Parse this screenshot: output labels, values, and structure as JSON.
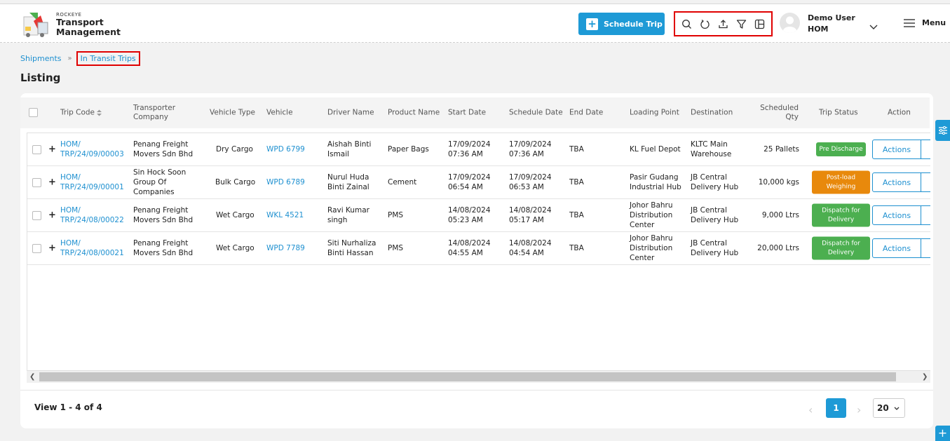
{
  "app": {
    "brand_small": "ROCKEYE",
    "brand_line1": "Transport",
    "brand_line2": "Management"
  },
  "header": {
    "schedule_label": "Schedule Trip",
    "tool_icons": [
      "search-icon",
      "refresh-icon",
      "upload-icon",
      "filter-icon",
      "columns-icon"
    ],
    "user_name": "Demo User",
    "user_org": "HOM",
    "menu_label": "Menu"
  },
  "breadcrumb": {
    "parent": "Shipments",
    "separator": "»",
    "current": "In Transit Trips"
  },
  "page": {
    "title": "Listing"
  },
  "table": {
    "columns": {
      "trip_code": "Trip Code",
      "transporter": "Transporter Company",
      "vehicle_type": "Vehicle Type",
      "vehicle": "Vehicle",
      "driver": "Driver Name",
      "product": "Product Name",
      "start_date": "Start Date",
      "schedule_date": "Schedule Date",
      "end_date": "End Date",
      "loading_point": "Loading Point",
      "destination": "Destination",
      "qty": "Scheduled Qty",
      "status": "Trip Status",
      "action": "Action"
    },
    "rows": [
      {
        "trip_code": "HOM/ TRP/24/09/00003",
        "transporter": "Penang Freight Movers Sdn Bhd",
        "vehicle_type": "Dry Cargo",
        "vehicle": "WPD 6799",
        "driver": "Aishah Binti Ismail",
        "product": "Paper Bags",
        "start_date": "17/09/2024 07:36 AM",
        "schedule_date": "17/09/2024 07:36 AM",
        "end_date": "TBA",
        "loading_point": "KL Fuel Depot",
        "destination": "KLTC Main Warehouse",
        "qty": "25 Pallets",
        "status": "Pre Discharge",
        "status_color": "#4caf50",
        "action_label": "Actions"
      },
      {
        "trip_code": "HOM/ TRP/24/09/00001",
        "transporter": "Sin Hock Soon Group Of Companies",
        "vehicle_type": "Bulk Cargo",
        "vehicle": "WPD 6789",
        "driver": "Nurul Huda Binti Zainal",
        "product": "Cement",
        "start_date": "17/09/2024 06:54 AM",
        "schedule_date": "17/09/2024 06:53 AM",
        "end_date": "TBA",
        "loading_point": "Pasir Gudang Industrial Hub",
        "destination": "JB Central Delivery Hub",
        "qty": "10,000 kgs",
        "status": "Post-load Weighing",
        "status_color": "#e8890c",
        "action_label": "Actions"
      },
      {
        "trip_code": "HOM/ TRP/24/08/00022",
        "transporter": "Penang Freight Movers Sdn Bhd",
        "vehicle_type": "Wet Cargo",
        "vehicle": "WKL 4521",
        "driver": "Ravi Kumar singh",
        "product": "PMS",
        "start_date": "14/08/2024 05:23 AM",
        "schedule_date": "14/08/2024 05:17 AM",
        "end_date": "TBA",
        "loading_point": "Johor Bahru Distribution Center",
        "destination": "JB Central Delivery Hub",
        "qty": "9,000 Ltrs",
        "status": "Dispatch for Delivery",
        "status_color": "#4caf50",
        "action_label": "Actions"
      },
      {
        "trip_code": "HOM/ TRP/24/08/00021",
        "transporter": "Penang Freight Movers Sdn Bhd",
        "vehicle_type": "Wet Cargo",
        "vehicle": "WPD 7789",
        "driver": "Siti Nurhaliza Binti Hassan",
        "product": "PMS",
        "start_date": "14/08/2024 04:55 AM",
        "schedule_date": "14/08/2024 04:54 AM",
        "end_date": "TBA",
        "loading_point": "Johor Bahru Distribution Center",
        "destination": "JB Central Delivery Hub",
        "qty": "20,000 Ltrs",
        "status": "Dispatch for Delivery",
        "status_color": "#4caf50",
        "action_label": "Actions"
      }
    ]
  },
  "footer": {
    "view_count": "View 1 - 4 of 4",
    "current_page": "1",
    "page_size": "20"
  },
  "colors": {
    "accent": "#1e9ad6",
    "highlight_box": "#e00000"
  }
}
